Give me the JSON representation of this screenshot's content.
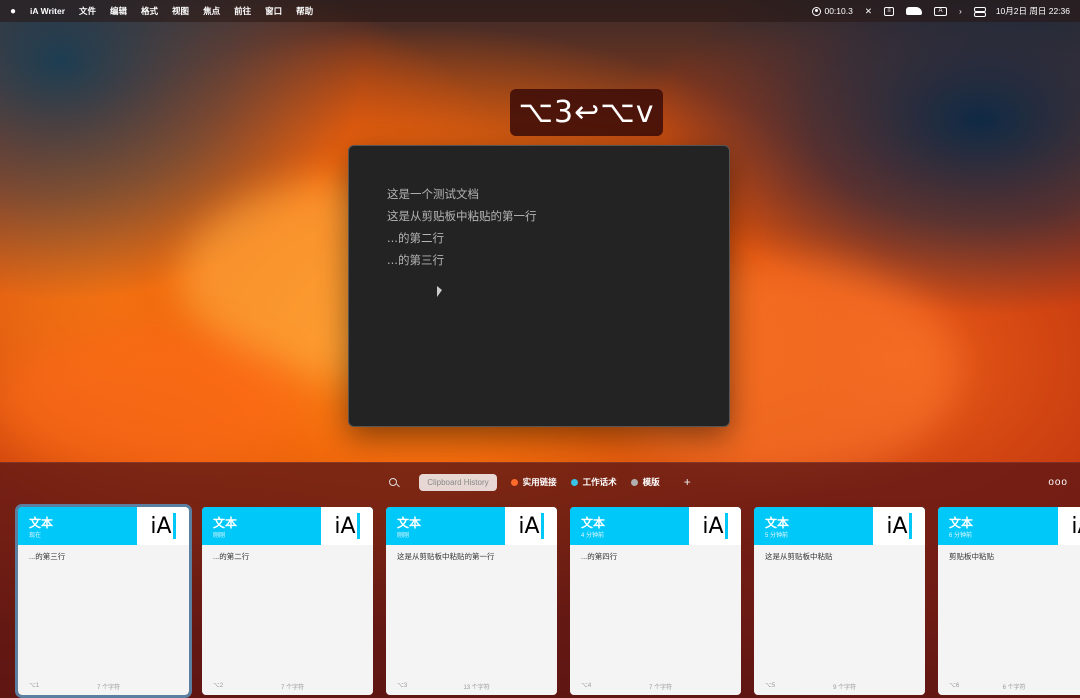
{
  "menubar": {
    "app_name": "iA Writer",
    "menus": [
      "文件",
      "编辑",
      "格式",
      "视图",
      "焦点",
      "前往",
      "窗口",
      "帮助"
    ],
    "recording_time": "00:10.3",
    "input_method": "A",
    "datetime": "10月2日 周日  22:36"
  },
  "keycast": {
    "keys": "⌥3↩⌥v"
  },
  "editor": {
    "lines": [
      "这是一个测试文档",
      "这是从剪贴板中粘贴的第一行",
      "...的第二行",
      "...的第三行"
    ]
  },
  "panel": {
    "search_pill": "Clipboard History",
    "tags": [
      {
        "label": "实用链接",
        "color": "#ff6a2a"
      },
      {
        "label": "工作话术",
        "color": "#37c2e8"
      },
      {
        "label": "模版",
        "color": "#b0b0b0"
      }
    ],
    "add_label": "+",
    "more_label": "ooo"
  },
  "cards": [
    {
      "title": "文本",
      "time": "现在",
      "body": "...的第三行",
      "shortcut": "⌥1",
      "count": "7 个字符",
      "logo": "iA"
    },
    {
      "title": "文本",
      "time": "刚刚",
      "body": "...的第二行",
      "shortcut": "⌥2",
      "count": "7 个字符",
      "logo": "iA"
    },
    {
      "title": "文本",
      "time": "刚刚",
      "body": "这是从剪贴板中粘贴的第一行",
      "shortcut": "⌥3",
      "count": "13 个字符",
      "logo": "iA"
    },
    {
      "title": "文本",
      "time": "4 分钟前",
      "body": "...的第四行",
      "shortcut": "⌥4",
      "count": "7 个字符",
      "logo": "iA"
    },
    {
      "title": "文本",
      "time": "5 分钟前",
      "body": "这是从剪贴板中粘贴",
      "shortcut": "⌥5",
      "count": "9 个字符",
      "logo": "iA"
    },
    {
      "title": "文本",
      "time": "6 分钟前",
      "body": "剪贴板中粘贴",
      "shortcut": "⌥6",
      "count": "6 个字符",
      "logo": "iA"
    }
  ],
  "colors": {
    "card_header": "#00c8f8",
    "panel_bg": "#5c1616",
    "editor_bg": "#232323"
  }
}
